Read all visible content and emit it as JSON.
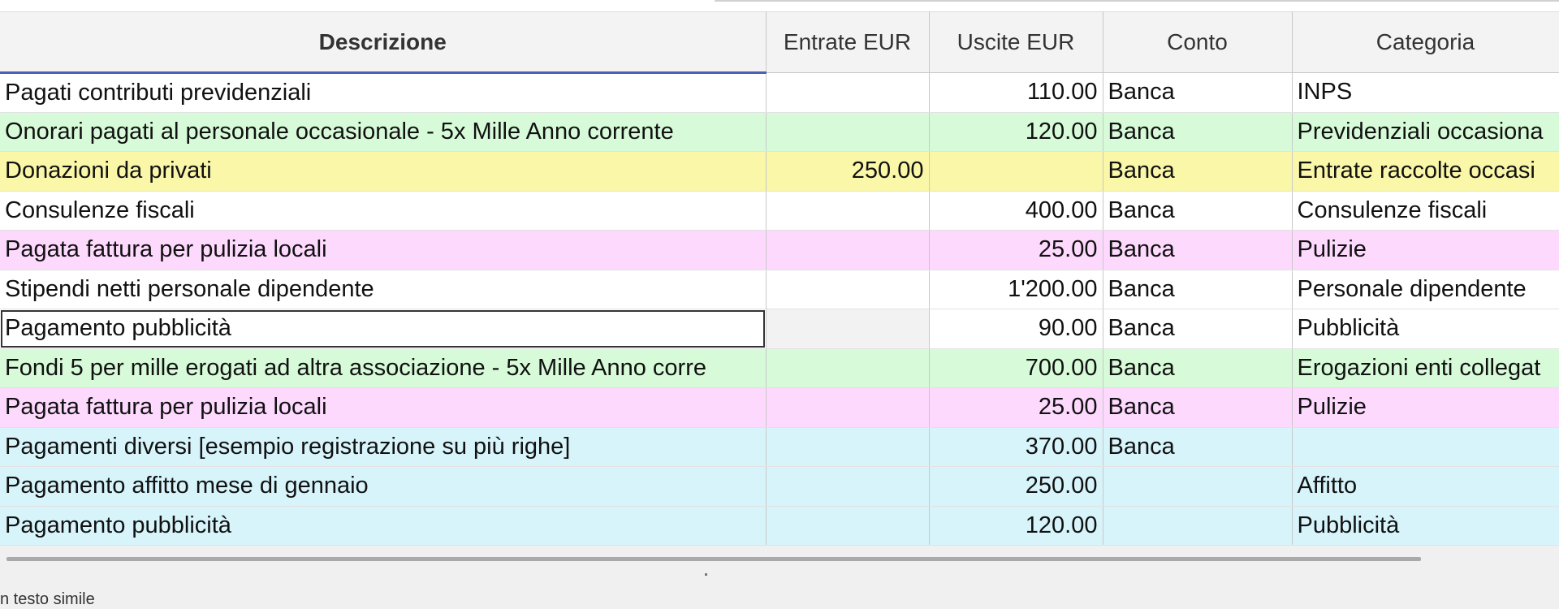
{
  "columns": {
    "descrizione": "Descrizione",
    "entrate": "Entrate EUR",
    "uscite": "Uscite EUR",
    "conto": "Conto",
    "categoria": "Categoria"
  },
  "rows": [
    {
      "descrizione": "Pagati contributi previdenziali",
      "entrate": "",
      "uscite": "110.00",
      "conto": "Banca",
      "categoria": "INPS",
      "color": "white"
    },
    {
      "descrizione": "Onorari pagati al personale occasionale - 5x Mille Anno corrente",
      "entrate": "",
      "uscite": "120.00",
      "conto": "Banca",
      "categoria": "Previdenziali occasiona",
      "color": "green"
    },
    {
      "descrizione": "Donazioni da privati",
      "entrate": "250.00",
      "uscite": "",
      "conto": "Banca",
      "categoria": "Entrate raccolte occasi",
      "color": "yellow"
    },
    {
      "descrizione": "Consulenze fiscali",
      "entrate": "",
      "uscite": "400.00",
      "conto": "Banca",
      "categoria": "Consulenze fiscali",
      "color": "white"
    },
    {
      "descrizione": "Pagata fattura per pulizia locali",
      "entrate": "",
      "uscite": "25.00",
      "conto": "Banca",
      "categoria": "Pulizie",
      "color": "pink"
    },
    {
      "descrizione": "Stipendi netti personale dipendente",
      "entrate": "",
      "uscite": "1'200.00",
      "conto": "Banca",
      "categoria": "Personale dipendente",
      "color": "white"
    },
    {
      "descrizione": "Pagamento pubblicità",
      "entrate": "",
      "uscite": "90.00",
      "conto": "Banca",
      "categoria": "Pubblicità",
      "color": "white"
    },
    {
      "descrizione": "Fondi 5 per mille erogati ad altra associazione - 5x Mille Anno corre",
      "entrate": "",
      "uscite": "700.00",
      "conto": "Banca",
      "categoria": "Erogazioni enti collegat",
      "color": "green"
    },
    {
      "descrizione": "Pagata fattura per pulizia locali",
      "entrate": "",
      "uscite": "25.00",
      "conto": "Banca",
      "categoria": "Pulizie",
      "color": "pink"
    },
    {
      "descrizione": "Pagamenti diversi [esempio registrazione su più righe]",
      "entrate": "",
      "uscite": "370.00",
      "conto": "Banca",
      "categoria": "",
      "color": "cyan"
    },
    {
      "descrizione": "Pagamento affitto mese di gennaio",
      "entrate": "",
      "uscite": "250.00",
      "conto": "",
      "categoria": "Affitto",
      "color": "cyan"
    },
    {
      "descrizione": "Pagamento pubblicità",
      "entrate": "",
      "uscite": "120.00",
      "conto": "",
      "categoria": "Pubblicità",
      "color": "cyan"
    }
  ],
  "status": {
    "text": "n testo simile"
  }
}
